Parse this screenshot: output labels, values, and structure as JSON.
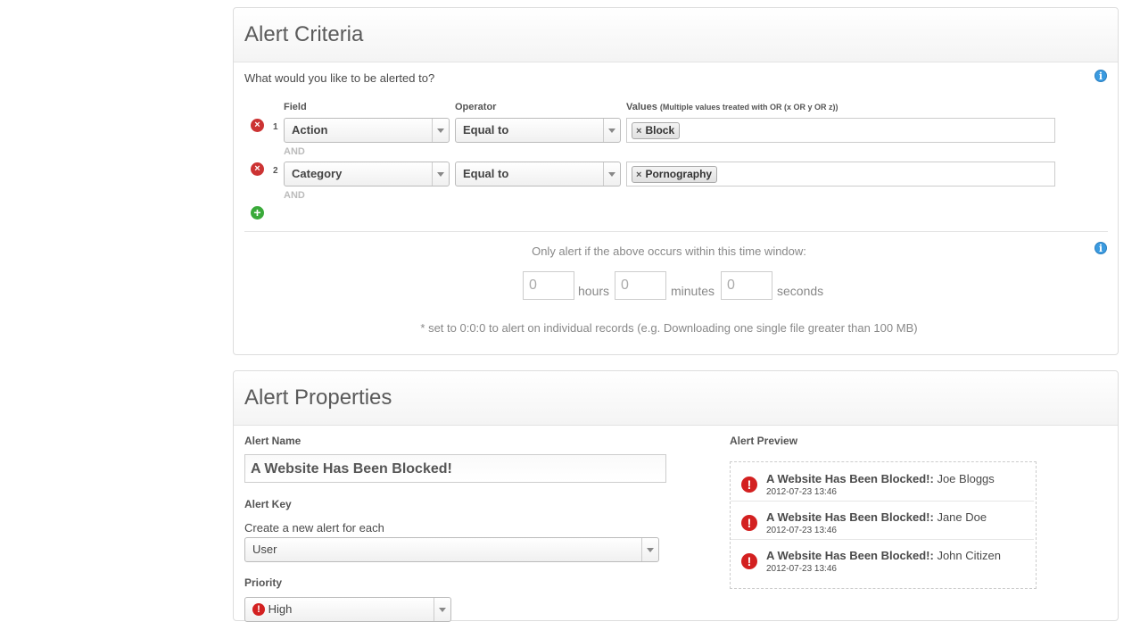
{
  "criteria": {
    "title": "Alert Criteria",
    "question": "What would you like to be alerted to?",
    "headers": {
      "field": "Field",
      "operator": "Operator",
      "values": "Values",
      "values_note": "(Multiple values treated with OR (x OR y OR z))"
    },
    "rows": [
      {
        "num": "1",
        "field": "Action",
        "operator": "Equal to",
        "tag": "Block",
        "connector": "AND"
      },
      {
        "num": "2",
        "field": "Category",
        "operator": "Equal to",
        "tag": "Pornography",
        "connector": "AND"
      }
    ],
    "window_text": "Only alert if the above occurs within this time window:",
    "hours_value": "0",
    "hours_label": "hours",
    "minutes_value": "0",
    "minutes_label": "minutes",
    "seconds_value": "0",
    "seconds_label": "seconds",
    "note": "* set to 0:0:0 to alert on individual records (e.g. Downloading one single file greater than 100 MB)"
  },
  "properties": {
    "title": "Alert Properties",
    "name_label": "Alert Name",
    "name_value": "A Website Has Been Blocked!",
    "key_label": "Alert Key",
    "key_help": "Create a new alert for each",
    "key_value": "User",
    "priority_label": "Priority",
    "priority_value": "High",
    "preview_label": "Alert Preview",
    "preview": [
      {
        "title": "A Website Has Been Blocked!:",
        "user": "Joe Bloggs",
        "time": "2012-07-23 13:46"
      },
      {
        "title": "A Website Has Been Blocked!:",
        "user": "Jane Doe",
        "time": "2012-07-23 13:46"
      },
      {
        "title": "A Website Has Been Blocked!:",
        "user": "John Citizen",
        "time": "2012-07-23 13:46"
      }
    ]
  },
  "colors": {
    "remove": "#cc3333",
    "add": "#3aaa3a",
    "info": "#3b9be0",
    "alert": "#d32020"
  }
}
